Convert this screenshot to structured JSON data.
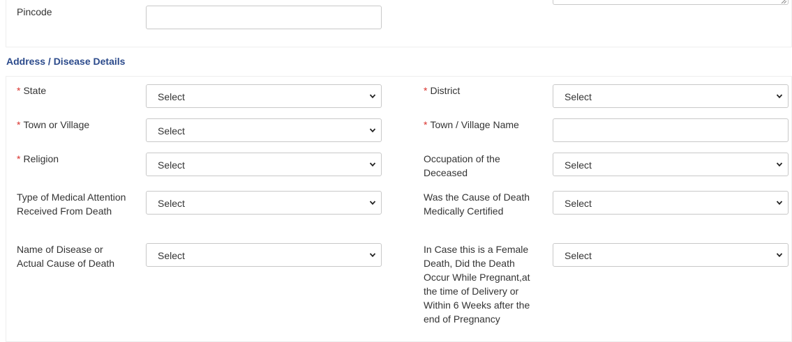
{
  "top": {
    "pincode_label": "Pincode",
    "pincode_value": ""
  },
  "section_title": "Address / Disease Details",
  "req_mark": "*",
  "fields": {
    "state": {
      "label": "State",
      "value": "Select"
    },
    "district": {
      "label": "District",
      "value": "Select"
    },
    "town_or_village": {
      "label": "Town or Village",
      "value": "Select"
    },
    "town_village_name": {
      "label": "Town / Village Name",
      "value": ""
    },
    "religion": {
      "label": "Religion",
      "value": "Select"
    },
    "occupation": {
      "label": "Occupation of the Deceased",
      "value": "Select"
    },
    "medical_attention": {
      "label": "Type of Medical Attention Received From Death",
      "value": "Select"
    },
    "medically_certified": {
      "label": "Was the Cause of Death Medically Certified",
      "value": "Select"
    },
    "disease_cause": {
      "label": "Name of Disease or Actual Cause of Death",
      "value": "Select"
    },
    "female_death_pregnancy": {
      "label": "In Case this is a Female Death, Did the Death Occur While Pregnant,at the time of Delivery or Within 6 Weeks after the end of Pregnancy",
      "value": "Select"
    }
  },
  "icons": {
    "dropdown": "chevron-down-icon",
    "resize": "resize-grip-icon"
  },
  "colors": {
    "section_title": "#2b4a8b",
    "required_mark": "#d9312c",
    "text": "#333333",
    "border": "#c8c8c8"
  }
}
